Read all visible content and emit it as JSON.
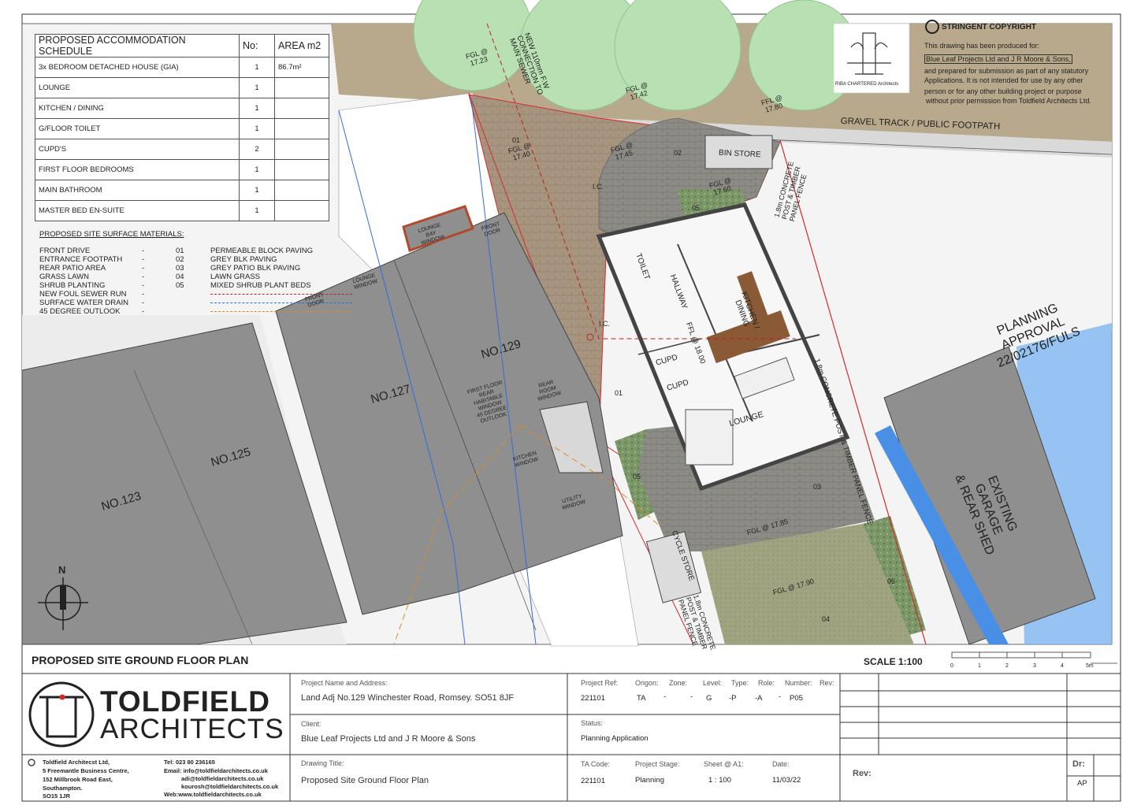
{
  "schedule": {
    "headers": [
      "PROPOSED ACCOMMODATION SCHEDULE",
      "No:",
      "AREA m2"
    ],
    "rows": [
      {
        "item": "3x BEDROOM DETACHED HOUSE (GIA)",
        "no": "1",
        "area": "86.7m²"
      },
      {
        "item": "LOUNGE",
        "no": "1",
        "area": ""
      },
      {
        "item": "KITCHEN  / DINING",
        "no": "1",
        "area": ""
      },
      {
        "item": "G/FLOOR TOILET",
        "no": "1",
        "area": ""
      },
      {
        "item": "CUPD'S",
        "no": "2",
        "area": ""
      },
      {
        "item": "FIRST FLOOR BEDROOMS",
        "no": "1",
        "area": ""
      },
      {
        "item": "MAIN BATHROOM",
        "no": "1",
        "area": ""
      },
      {
        "item": "MASTER BED EN-SUITE",
        "no": "1",
        "area": ""
      }
    ]
  },
  "materials": {
    "title": "PROPOSED SITE SURFACE MATERIALS:",
    "items": [
      {
        "name": "FRONT DRIVE",
        "dash": "-",
        "code": "01",
        "desc": "PERMEABLE BLOCK PAVING"
      },
      {
        "name": "ENTRANCE FOOTPATH",
        "dash": "-",
        "code": "02",
        "desc": "GREY BLK PAVING"
      },
      {
        "name": "REAR PATIO AREA",
        "dash": "-",
        "code": "03",
        "desc": "GREY PATIO BLK PAVING"
      },
      {
        "name": "GRASS LAWN",
        "dash": "-",
        "code": "04",
        "desc": "LAWN GRASS"
      },
      {
        "name": "SHRUB PLANTING",
        "dash": "-",
        "code": "05",
        "desc": "MIXED SHRUB PLANT BEDS"
      },
      {
        "name": "NEW FOUL SEWER RUN",
        "dash": "-",
        "code": "",
        "desc": ""
      },
      {
        "name": "SURFACE WATER DRAIN",
        "dash": "-",
        "code": "",
        "desc": ""
      },
      {
        "name": "45 DEGREE OUTLOOK",
        "dash": "-",
        "code": "",
        "desc": ""
      }
    ]
  },
  "copyright": {
    "title": "STRINGENT COPYRIGHT",
    "line1": "This drawing has been produced for:",
    "line2": "Blue Leaf Projects Ltd and J R Moore & Sons,",
    "line3": "and prepared for submission as part of any statutory",
    "line4": "Applications. It is not intended for use by any other",
    "line5": "person or for any other building project or purpose",
    "line6": "without prior permission from Toldfield Architects Ltd.",
    "riba": "RIBA CHARTERED Architects"
  },
  "plan": {
    "gravel_track": "GRAVEL TRACK / PUBLIC FOOTPATH",
    "planning_approval_1": "PLANNING",
    "planning_approval_2": "APPROVAL",
    "planning_approval_3": "22/02176/FULS",
    "existing_1": "EXISTING",
    "existing_2": "GARAGE",
    "existing_3": "& REAR SHED",
    "no123": "NO.123",
    "no125": "NO.125",
    "no127": "NO.127",
    "no129": "NO.129",
    "sewer_1": "NEW 110mm F.W",
    "sewer_2": "CONNECTION TO",
    "sewer_3": "MAIN SEWER",
    "fgl_1723": "FGL @",
    "fgl_1723v": "17.23",
    "fgl_1742": "FGL @",
    "fgl_1742v": "17.42",
    "fgl_1780": "FFL @",
    "fgl_1780v": "17.80",
    "fgl_1740": "FGL @",
    "fgl_1740v": "17.40",
    "fgl_1745": "FGL @",
    "fgl_1745v": "17.45",
    "fgl_1760": "FGL @",
    "fgl_1760v": "17.60",
    "bin_store": "BIN STORE",
    "fence_front_1": "1.8m CONCRETE",
    "fence_front_2": "POST & TIMBER",
    "fence_front_3": "PANEL FENCE",
    "fence_side": "1.8m CONCRETE POST & TIMBER PANEL FENCE",
    "fence_rear_1": "1.8m CONCRETE",
    "fence_rear_2": "POST & TIMBER",
    "fence_rear_3": "PANEL FENCE",
    "ic1": "I.C.",
    "ic2": "I.C.",
    "toilet": "TOILET",
    "hallway": "HALLWAY",
    "kitchen": "KITCHEN /",
    "kitchen2": "DINING",
    "ffl": "FFL @ 18.00",
    "cupd1": "CUPD",
    "cupd2": "CUPD",
    "lounge": "LOUNGE",
    "zone01a": "01",
    "zone01b": "01",
    "zone02": "02",
    "zone03": "03",
    "zone04": "04",
    "zone05a": "05",
    "zone05b": "05",
    "zone05c": "05",
    "fgl_1785": "FGL @ 17.85",
    "fgl_1790": "FGL @ 17.90",
    "cycle_store": "CYCLE STORE",
    "lounge_bay_1": "LOUNGE",
    "lounge_bay_2": "BAY",
    "lounge_bay_3": "WINDOW",
    "front_door_a1": "FRONT",
    "front_door_a2": "DOOR",
    "lounge_window_1": "LOUNGE",
    "lounge_window_2": "WINDOW",
    "front_door_b1": "FRONT",
    "front_door_b2": "DOOR",
    "ff_1": "FIRST FLOOR",
    "ff_2": "REAR",
    "ff_3": "HABITABLE",
    "ff_4": "WINDOW",
    "ff_5": "45 DEGREE",
    "ff_6": "OUTLOOK",
    "rear_room_1": "REAR",
    "rear_room_2": "ROOM",
    "rear_room_3": "WINDOW",
    "kitchen_window_1": "KITCHEN",
    "kitchen_window_2": "WINDOW",
    "utility_window_1": "UTILITY",
    "utility_window_2": "WINDOW",
    "north": "N"
  },
  "sheet": {
    "title": "PROPOSED SITE GROUND FLOOR PLAN",
    "scale": "SCALE  1:100",
    "scale_ticks": [
      "0",
      "1",
      "2",
      "3",
      "4",
      "5m"
    ]
  },
  "title_block": {
    "logo_line1": "TOLDFIELD",
    "logo_line2": "ARCHITECTS",
    "company": "Toldfield Architecst Ltd,",
    "address1": "5 Freemantle Business Centre,",
    "address2": "152 Millbrook Road East,",
    "address3": "Southampton.",
    "address4": "SO15 1JR",
    "tel": "Tel: 023 80 236165",
    "email1": "Email: info@toldfieldarchitects.co.uk",
    "email2": "adi@toldfieldarchitects.co.uk",
    "email3": "kourosh@toldfieldarchitects.co.uk",
    "web": "Web:www.toldfieldarchitects.co.uk",
    "project_label": "Project Name and Address:",
    "project_value": "Land Adj No.129 Winchester Road, Romsey. SO51 8JF",
    "client_label": "Client:",
    "client_value": "Blue Leaf Projects Ltd and J R Moore & Sons",
    "drawing_label": "Drawing Title:",
    "drawing_value": "Proposed Site Ground Floor Plan",
    "ref_labels": [
      "Project Ref:",
      "Origon:",
      "Zone:",
      "Level:",
      "Type:",
      "Role:",
      "Number:",
      "Rev:"
    ],
    "ref_values": [
      "221101",
      "TA",
      "-",
      "-",
      "G",
      "-P",
      "-A",
      "-",
      "P05"
    ],
    "status_label": "Status:",
    "status_value": "Planning Application",
    "ta_code_label": "TA Code:",
    "ta_code_value": "221101",
    "stage_label": "Project Stage:",
    "stage_value": "Planning",
    "sheet_label": "Sheet @ A1:",
    "sheet_value": "1 : 100",
    "date_label": "Date:",
    "date_value": "11/03/22",
    "rev_label": "Rev:",
    "dr_label": "Dr:",
    "dr_value": "AP"
  },
  "colors": {
    "tree": "#b7dfb2",
    "tree_edge": "#8fc58a",
    "track": "#b3a486",
    "building": "#8f8f8f",
    "building_edge": "#444444",
    "road": "#ececec",
    "paving_brown": "#a99781",
    "paving_grey": "#8e8a84",
    "lawn": "#9da17d",
    "shrub": "#6f8a5e",
    "water": "#2f6fd6",
    "boundary": "#d52a2a",
    "garage_blue": "#4a8fe6",
    "sky_blue": "#7fb6f2"
  }
}
